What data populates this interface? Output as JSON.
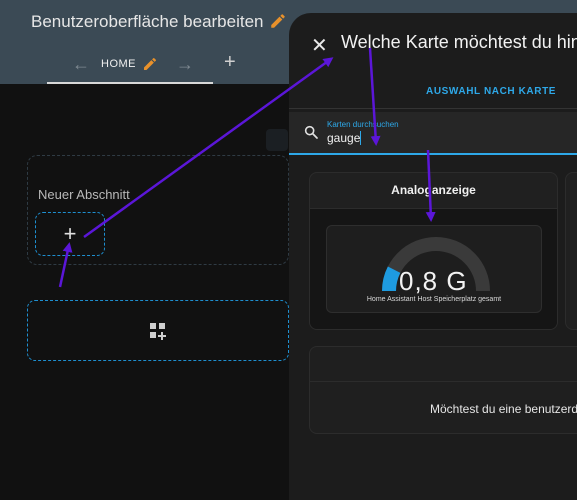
{
  "editor": {
    "title": "Benutzeroberfläche bearbeiten",
    "tab_home": "HOME",
    "arrow_left": "←",
    "arrow_right": "→",
    "add_tab": "+",
    "section_label": "Neuer Abschnitt",
    "section_add": "+"
  },
  "dialog": {
    "close": "✕",
    "title": "Welche Karte möchtest du hinzufügen?",
    "tab_label": "AUSWAHL NACH KARTE",
    "search_label": "Karten durchsuchen",
    "search_value": "gauge",
    "card_title": "Analoganzeige",
    "gauge_value": "0,8 G",
    "gauge_level": 0.15,
    "gauge_name": "Home Assistant Host Speicherplatz gesamt",
    "custom_text": "Möchtest du eine benutzerdefinierte Karte hinzufügen?"
  },
  "colors": {
    "accent": "#2ea8e8",
    "dashed_border": "#1e8fd0",
    "edit_icon": "#e8912b",
    "annotation_arrow": "#5b16d8",
    "topbar": "#3b4a55"
  }
}
